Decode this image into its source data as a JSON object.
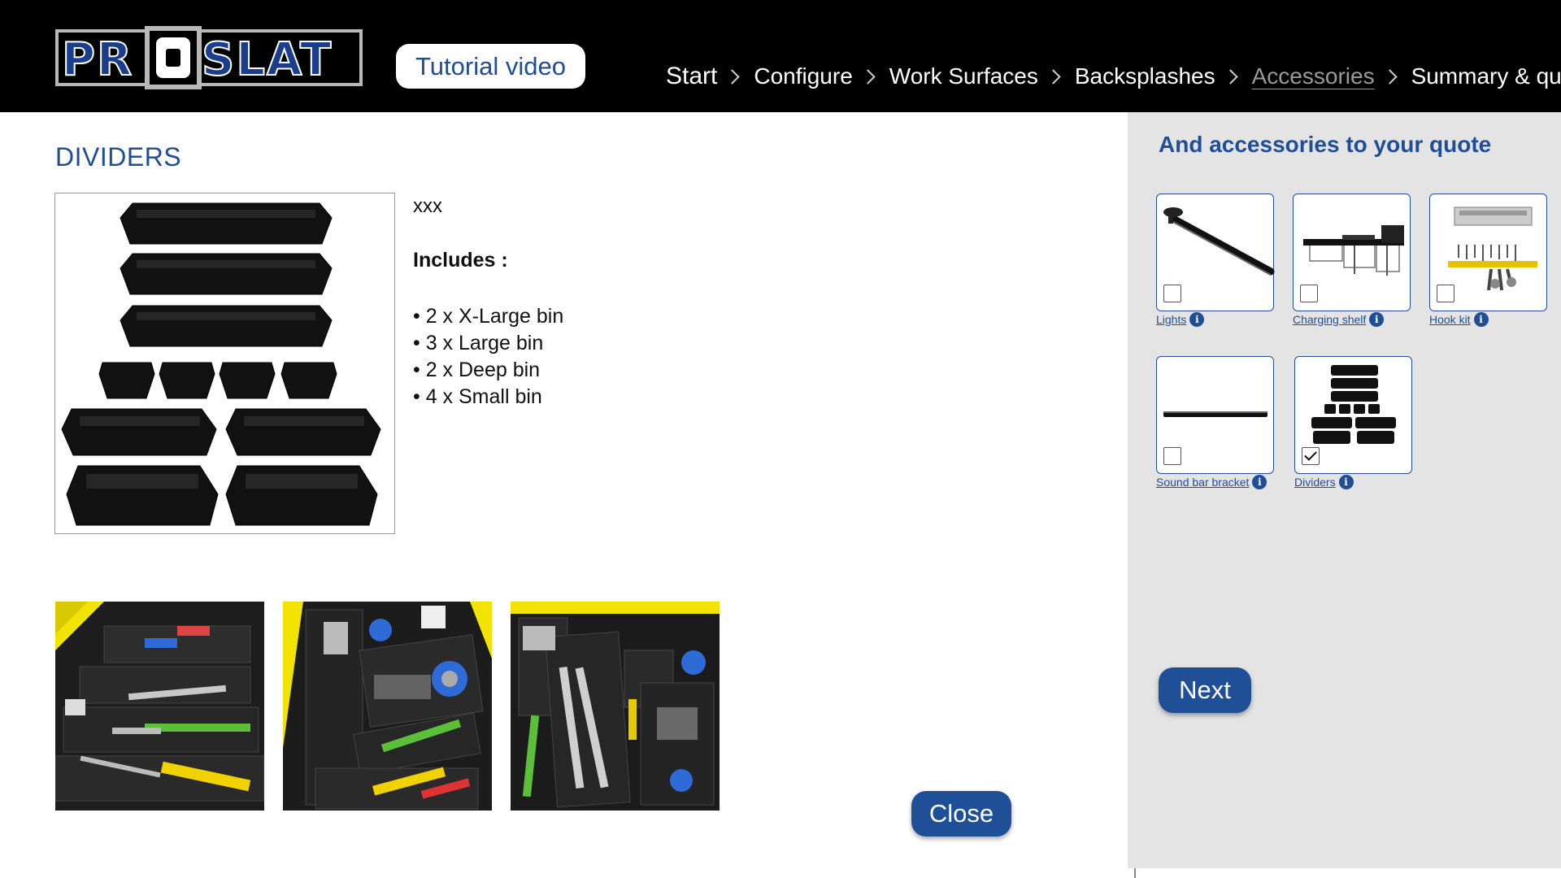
{
  "header": {
    "logo_text": "PROSLAT",
    "tutorial_label": "Tutorial video",
    "breadcrumbs": [
      {
        "label": "Start"
      },
      {
        "label": "Configure"
      },
      {
        "label": "Work Surfaces"
      },
      {
        "label": "Backsplashes"
      },
      {
        "label": "Accessories",
        "active": true
      },
      {
        "label": "Summary & quote"
      }
    ]
  },
  "main": {
    "title": "DIVIDERS",
    "description": "xxx",
    "includes_label": "Includes :",
    "includes": [
      "• 2 x X-Large bin",
      "• 3 x Large bin",
      "• 2 x Deep bin",
      "• 4 x Small bin"
    ],
    "close_label": "Close"
  },
  "panel": {
    "title": "And accessories to your quote",
    "items": [
      {
        "label": "Lights",
        "checked": false,
        "icon": "light-bar-icon"
      },
      {
        "label": "Charging shelf",
        "checked": false,
        "icon": "charging-shelf-icon"
      },
      {
        "label": "Hook kit",
        "checked": false,
        "icon": "hook-kit-icon"
      },
      {
        "label": "Sound bar bracket",
        "checked": false,
        "icon": "sound-bar-icon"
      },
      {
        "label": "Dividers",
        "checked": true,
        "icon": "dividers-icon"
      }
    ],
    "info_glyph": "i",
    "next_label": "Next"
  },
  "colors": {
    "header_bg": "#000000",
    "brand_blue": "#1f4e96",
    "panel_bg": "#e4e4e4",
    "logo_silver": "#b8b8b8"
  }
}
